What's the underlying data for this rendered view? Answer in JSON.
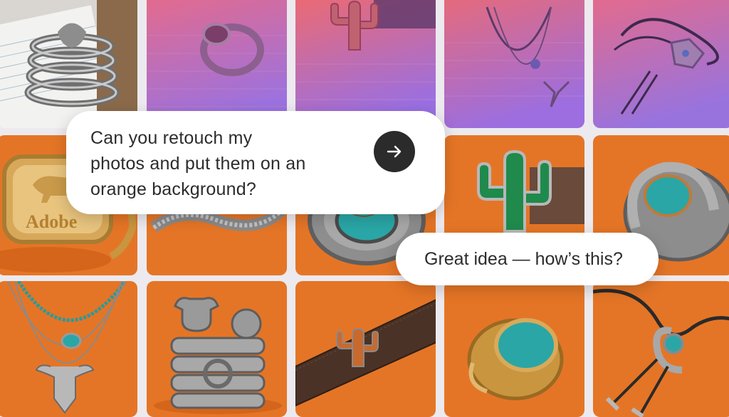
{
  "chat": {
    "prompt": "Can you retouch my\nphotos and put them on an\norange background?",
    "reply": "Great idea — how’s this?",
    "send_icon": "arrow-right-icon"
  },
  "photos": {
    "ring_engraving": "Adobe"
  },
  "colors": {
    "orange_background": "#e57526",
    "gradient_top": "#d65a8c",
    "gradient_bottom": "#8b6be0",
    "send_button": "#2b2b2b",
    "bubble": "#ffffff",
    "turquoise": "#2aa6a6"
  }
}
